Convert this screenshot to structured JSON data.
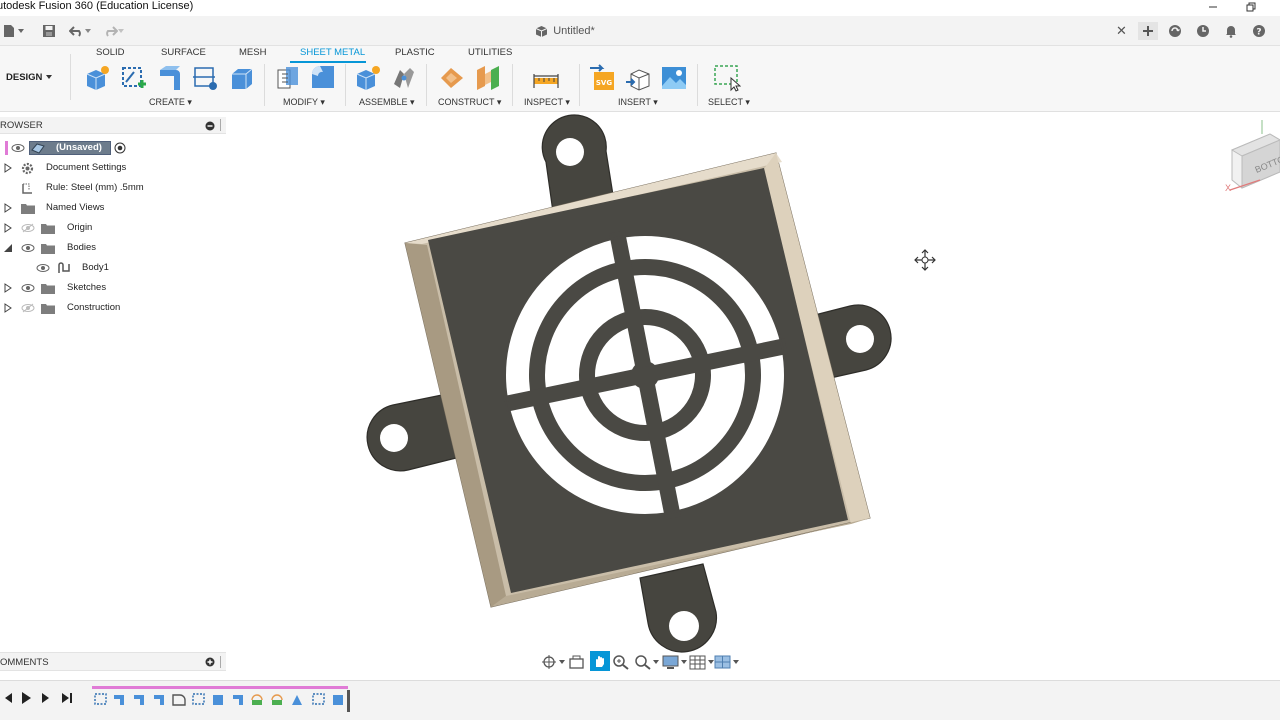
{
  "app": {
    "title": "utodesk Fusion 360 (Education License)"
  },
  "document": {
    "tab_title": "Untitled*"
  },
  "ribbon": {
    "workspace": "DESIGN",
    "tabs": [
      "SOLID",
      "SURFACE",
      "MESH",
      "SHEET METAL",
      "PLASTIC",
      "UTILITIES"
    ],
    "active_tab": "SHEET METAL",
    "groups": {
      "create": "CREATE",
      "modify": "MODIFY",
      "assemble": "ASSEMBLE",
      "construct": "CONSTRUCT",
      "inspect": "INSPECT",
      "insert": "INSERT",
      "select": "SELECT"
    }
  },
  "browser": {
    "title": "ROWSER",
    "root": "(Unsaved)",
    "items": {
      "document_settings": "Document Settings",
      "rule": "Rule: Steel (mm) .5mm",
      "named_views": "Named Views",
      "origin": "Origin",
      "bodies": "Bodies",
      "body1": "Body1",
      "sketches": "Sketches",
      "construction": "Construction"
    }
  },
  "comments": {
    "title": "OMMENTS"
  },
  "viewcube": {
    "face": "BOTTOM",
    "axis": "X"
  },
  "colors": {
    "accent": "#0696d7",
    "sheet_metal_face": "#4a4944",
    "sheet_metal_edge": "#d6cbb8",
    "timeline_marker": "#e07bd6"
  },
  "icons": [
    "save-icon",
    "undo-icon",
    "redo-icon",
    "file-menu-icon",
    "close-icon",
    "add-tab-icon",
    "online-status-icon",
    "job-status-icon",
    "notifications-icon",
    "help-icon",
    "eye-icon",
    "folder-icon",
    "gear-icon",
    "orbit-icon",
    "pan-icon",
    "zoom-icon",
    "display-settings-icon",
    "grid-icon",
    "play-icon"
  ]
}
